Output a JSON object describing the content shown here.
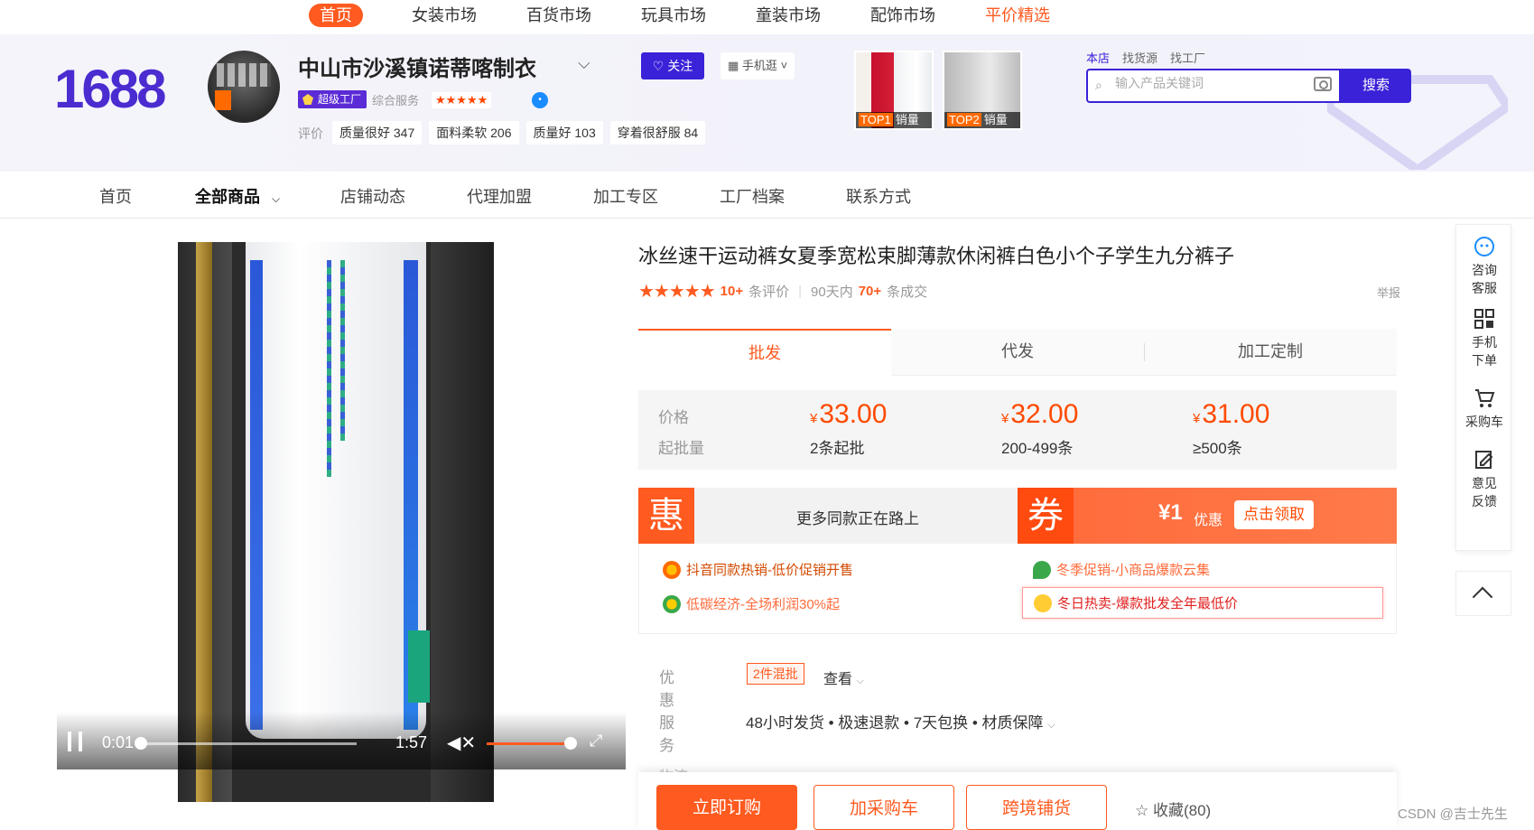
{
  "top_nav": {
    "items": [
      "首页",
      "女装市场",
      "百货市场",
      "玩具市场",
      "童装市场",
      "配饰市场",
      "平价精选"
    ]
  },
  "header": {
    "logo": "1688",
    "shop_name": "中山市沙溪镇诺蒂喀制衣",
    "follow": "关注",
    "mobile_shop": "手机逛",
    "super_factory": "超级工厂",
    "composite_service": "综合服务",
    "composite_stars": "★★★★★",
    "evaluation_label": "评价",
    "evaluation_tags": [
      "质量很好 347",
      "面料柔软 206",
      "质量好 103",
      "穿着很舒服 84"
    ],
    "top_products": [
      {
        "rank": "TOP1",
        "label": "销量"
      },
      {
        "rank": "TOP2",
        "label": "销量"
      }
    ],
    "search_tabs": [
      "本店",
      "找货源",
      "找工厂"
    ],
    "search_placeholder": "输入产品关键词",
    "search_button": "搜索"
  },
  "shop_nav": {
    "items": [
      "首页",
      "全部商品",
      "店铺动态",
      "代理加盟",
      "加工专区",
      "工厂档案",
      "联系方式"
    ]
  },
  "video": {
    "current_time": "0:01",
    "duration": "1:57"
  },
  "product": {
    "title": "冰丝速干运动裤女夏季宽松束脚薄款休闲裤白色小个子学生九分裤子",
    "stars": "★★★★★",
    "review_count": "10+",
    "review_label": "条评价",
    "sales_prefix": "90天内",
    "sales_count": "70+",
    "sales_label": "条成交",
    "report": "举报",
    "tabs": [
      "批发",
      "代发",
      "加工定制"
    ],
    "price_label": "价格",
    "moq_label": "起批量",
    "currency": "¥",
    "tiers": [
      {
        "price": "33.00",
        "moq": "2条起批"
      },
      {
        "price": "32.00",
        "moq": "200-499条"
      },
      {
        "price": "31.00",
        "moq": "≥500条"
      }
    ],
    "promo": {
      "hui": "惠",
      "hui_text": "更多同款正在路上",
      "quan": "券",
      "coupon_amount": "¥1",
      "coupon_unit": "优惠",
      "coupon_button": "点击领取"
    },
    "activities": [
      "抖音同款热销-低价促销开售",
      "冬季促销-小商品爆款云集",
      "低碳经济-全场利润30%起",
      "冬日热卖-爆款批发全年最低价"
    ],
    "discount_label": "优惠",
    "discount_badge": "2件混批",
    "discount_link": "查看",
    "service_label": "服务",
    "service_text": "48小时发货 • 极速退款 • 7天包换 • 材质保障",
    "logistics_label": "物流",
    "buttons": {
      "order": "立即订购",
      "cart": "加采购车",
      "cross_border": "跨境铺货",
      "favorite": "收藏(80)"
    }
  },
  "side_bar": {
    "items": [
      "咨询客服",
      "手机下单",
      "采购车",
      "意见反馈"
    ]
  },
  "watermark": "CSDN @吉士先生"
}
